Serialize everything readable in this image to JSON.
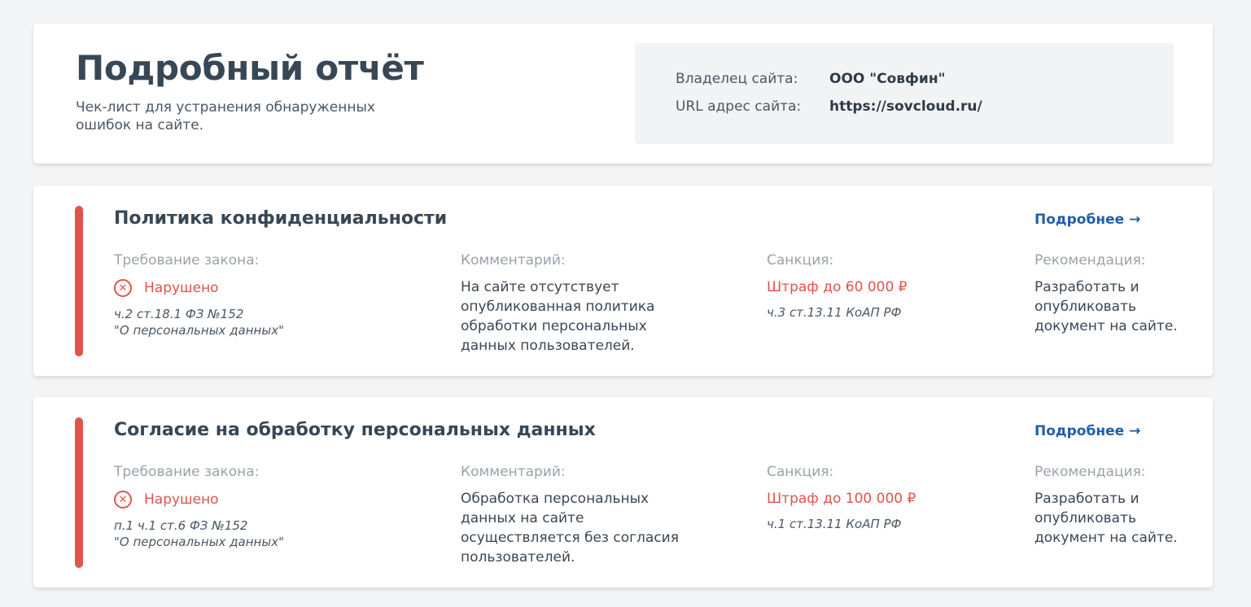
{
  "header": {
    "title": "Подробный отчёт",
    "subtitle": "Чек-лист для устранения обнаруженных ошибок на сайте.",
    "owner_label": "Владелец сайта:",
    "owner_value": "ООО \"Совфин\"",
    "url_label": "URL адрес сайта:",
    "url_value": "https://sovcloud.ru/"
  },
  "colors": {
    "accent": "#e0544b",
    "link": "#1f5fa8",
    "title": "#374755"
  },
  "issues": [
    {
      "title": "Политика конфиденциальности",
      "more_label": "Подробнее →",
      "law_label": "Требование закона:",
      "status_icon": "cross-circle-icon",
      "status": "Нарушено",
      "law_ref_1": "ч.2 ст.18.1 ФЗ №152",
      "law_ref_2": "\"О персональных данных\"",
      "comment_label": "Комментарий:",
      "comment": "На сайте отсутствует опубликованная политика обработки персональных данных пользователей.",
      "sanction_label": "Санкция:",
      "fine": "Штраф до 60 000 ₽",
      "fine_ref": "ч.3 ст.13.11 КоАП РФ",
      "rec_label": "Рекомендация:",
      "rec": "Разработать и опубликовать документ на сайте."
    },
    {
      "title": "Согласие на обработку персональных данных",
      "more_label": "Подробнее →",
      "law_label": "Требование закона:",
      "status_icon": "cross-circle-icon",
      "status": "Нарушено",
      "law_ref_1": "п.1 ч.1 ст.6 ФЗ №152",
      "law_ref_2": "\"О персональных данных\"",
      "comment_label": "Комментарий:",
      "comment": "Обработка персональных данных на сайте осуществляется без согласия пользователей.",
      "sanction_label": "Санкция:",
      "fine": "Штраф до 100 000 ₽",
      "fine_ref": "ч.1 ст.13.11 КоАП РФ",
      "rec_label": "Рекомендация:",
      "rec": "Разработать и опубликовать документ на сайте."
    }
  ]
}
